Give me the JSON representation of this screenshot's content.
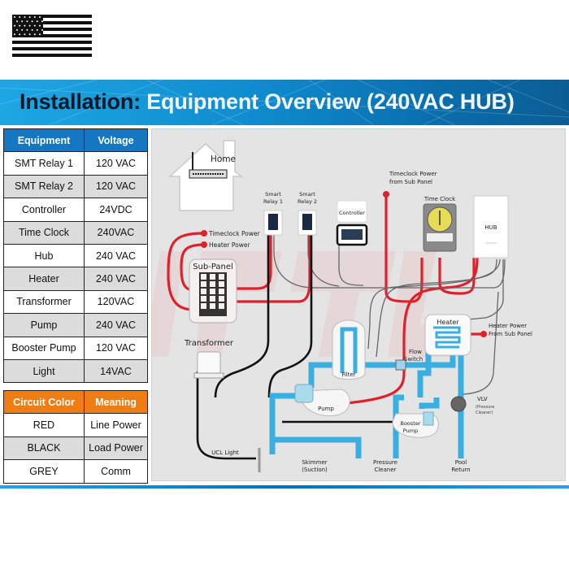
{
  "header": {
    "title_prefix": "Installation:",
    "title_main": "Equipment Overview (240VAC HUB)"
  },
  "equipment_table": {
    "headers": [
      "Equipment",
      "Voltage"
    ],
    "rows": [
      {
        "equipment": "SMT Relay 1",
        "voltage": "120 VAC"
      },
      {
        "equipment": "SMT Relay 2",
        "voltage": "120 VAC"
      },
      {
        "equipment": "Controller",
        "voltage": "24VDC"
      },
      {
        "equipment": "Time Clock",
        "voltage": "240VAC"
      },
      {
        "equipment": "Hub",
        "voltage": "240 VAC"
      },
      {
        "equipment": "Heater",
        "voltage": "240 VAC"
      },
      {
        "equipment": "Transformer",
        "voltage": "120VAC"
      },
      {
        "equipment": "Pump",
        "voltage": "240 VAC"
      },
      {
        "equipment": "Booster Pump",
        "voltage": "120 VAC"
      },
      {
        "equipment": "Light",
        "voltage": "14VAC"
      }
    ]
  },
  "circuit_table": {
    "headers": [
      "Circuit Color",
      "Meaning"
    ],
    "rows": [
      {
        "color": "RED",
        "meaning": "Line Power"
      },
      {
        "color": "BLACK",
        "meaning": "Load Power"
      },
      {
        "color": "GREY",
        "meaning": "Comm"
      }
    ]
  },
  "colors": {
    "line_power": "#e0202a",
    "load_power": "#111111",
    "comm": "#6a6a6a",
    "water_pipe": "#39aee0",
    "equipment_header": "#1576c2",
    "circuit_header": "#f07d13"
  },
  "diagram": {
    "labels": {
      "home": "Home",
      "timeclock_power": "Timeclock Power",
      "heater_power": "Heater Power",
      "sub_panel": "Sub-Panel",
      "smart_relay_1": [
        "Smart",
        "Relay 1"
      ],
      "smart_relay_2": [
        "Smart",
        "Relay 2"
      ],
      "controller": "Controller",
      "timeclock_power_from_sub": [
        "Timeclock Power",
        "from Sub Panel"
      ],
      "time_clock": "Time Clock",
      "hub": "HUB",
      "transformer": "Transformer",
      "heater": "Heater",
      "heater_power_from_sub": [
        "Heater Power",
        "From Sub Panel"
      ],
      "flow_switch": [
        "Flow",
        "Switch"
      ],
      "filter": "Filter",
      "pump": "Pump",
      "vlv": "VLV",
      "vlv_sub": [
        "(Pressure",
        "Cleaner)"
      ],
      "booster_pump": [
        "Booster",
        "Pump"
      ],
      "ucl_light": "UCL Light",
      "skimmer": [
        "Skimmer",
        "(Suction)"
      ],
      "pressure_cleaner": [
        "Pressure",
        "Cleaner"
      ],
      "pool_return": [
        "Pool",
        "Return"
      ]
    }
  }
}
